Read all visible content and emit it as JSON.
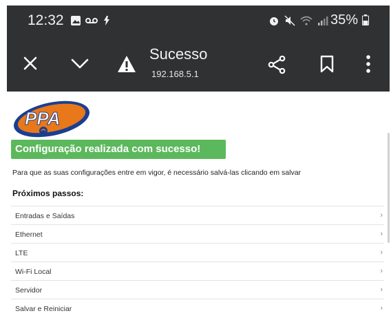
{
  "status_bar": {
    "time": "12:32",
    "battery": "35%",
    "left_icons": [
      "gallery-icon",
      "voicemail-icon",
      "notification-icon"
    ],
    "right_icons": [
      "alarm-icon",
      "mute-icon",
      "wifi-icon",
      "signal-icon",
      "battery-icon"
    ]
  },
  "toolbar": {
    "title": "Sucesso",
    "subtitle": "192.168.5.1",
    "icons": [
      "close-icon",
      "chevron-down-icon",
      "warning-icon",
      "share-icon",
      "bookmark-icon",
      "more-vertical-icon"
    ]
  },
  "page": {
    "logo_text": "PPA",
    "banner": "Configuração realizada com sucesso!",
    "info": "Para que as suas configurações entre em vigor, é necessário salvá-las clicando em salvar",
    "next_title": "Próximos passos:",
    "steps": [
      {
        "label": "Entradas e Saídas"
      },
      {
        "label": "Ethernet"
      },
      {
        "label": "LTE"
      },
      {
        "label": "Wi-Fi Local"
      },
      {
        "label": "Servidor"
      },
      {
        "label": "Salvar e Reiniciar"
      }
    ],
    "chevron": "›"
  },
  "colors": {
    "toolbar_bg": "#2f3133",
    "banner_bg": "#5cb85c",
    "logo_orange": "#e8781a",
    "logo_blue": "#1b3f8f"
  }
}
